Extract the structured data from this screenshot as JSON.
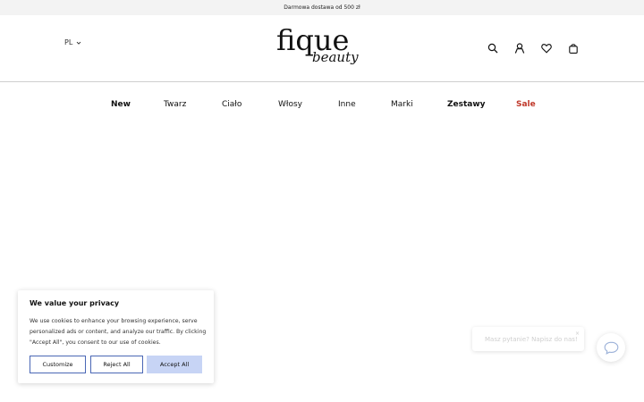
{
  "topbar": {
    "promo_text": "Darmowa dostawa od 500 zł"
  },
  "header": {
    "language": "PL",
    "logo": {
      "primary": "fique",
      "secondary": "beauty"
    },
    "icons": [
      "search-icon",
      "user-icon",
      "heart-icon",
      "bag-icon"
    ]
  },
  "nav": {
    "items": [
      {
        "label": "New"
      },
      {
        "label": "Twarz"
      },
      {
        "label": "Ciało"
      },
      {
        "label": "Włosy"
      },
      {
        "label": "Inne"
      },
      {
        "label": "Marki"
      },
      {
        "label": "Zestawy"
      },
      {
        "label": "Sale"
      }
    ]
  },
  "cookie_banner": {
    "title": "We value your privacy",
    "text": "We use cookies to enhance your browsing experience, serve personalized ads or content, and analyze our traffic. By clicking \"Accept All\", you consent to our use of cookies.",
    "customize_label": "Customize",
    "reject_label": "Reject All",
    "accept_label": "Accept All"
  },
  "chat": {
    "bubble_text": "Masz pytanie? Napisz do nas!",
    "close_label": "×"
  },
  "colors": {
    "sale": "#c0392b",
    "button_border": "#4a67b5",
    "accept_bg": "#c7d4f5",
    "topbar_bg": "#f3f3f3"
  }
}
